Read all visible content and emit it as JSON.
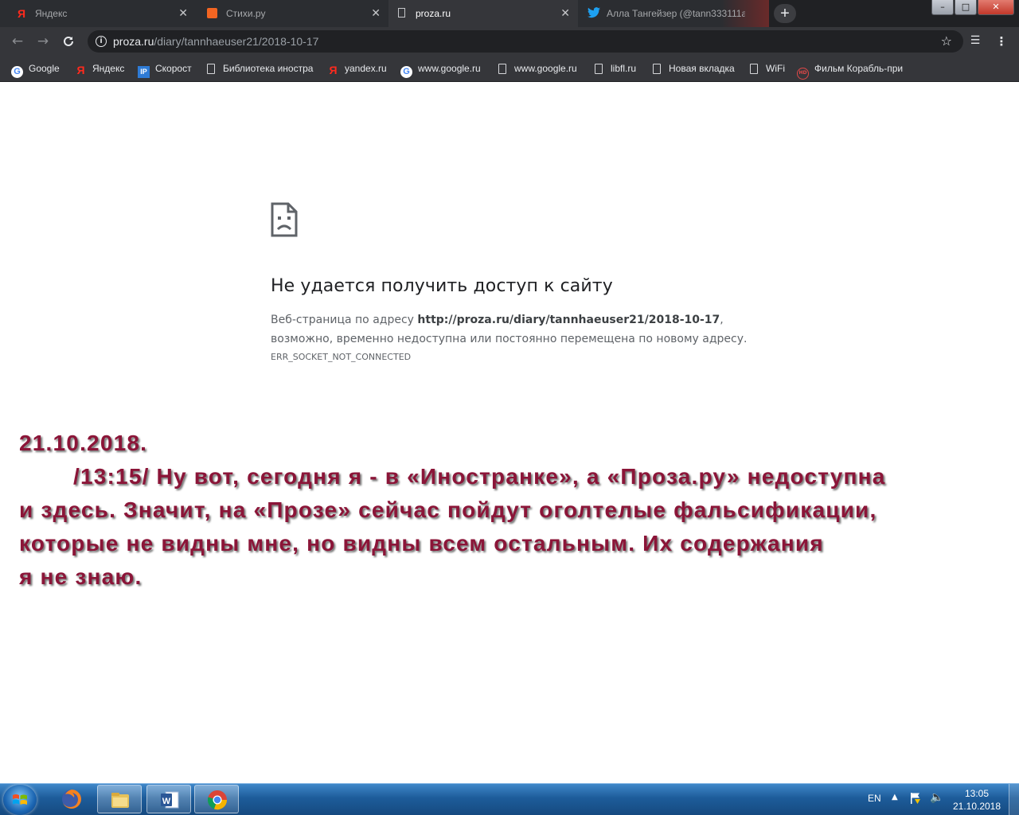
{
  "browser": {
    "tabs": [
      {
        "title": "Яндекс",
        "icon": "yandex-icon",
        "active": false
      },
      {
        "title": "Стихи.ру",
        "icon": "stihi-icon",
        "active": false
      },
      {
        "title": "proza.ru",
        "icon": "page-icon",
        "active": true
      },
      {
        "title": "Алла Тангейзер (@tann333111a",
        "icon": "twitter-icon",
        "active": false
      }
    ],
    "new_tab_symbol": "+",
    "window_controls": {
      "minimize": "–",
      "maximize": "□",
      "close": "✕"
    },
    "address": {
      "host": "proza.ru",
      "path": "/diary/tannhaeuser21/2018-10-17"
    },
    "bookmarks": [
      {
        "label": "Google",
        "icon": "google-icon"
      },
      {
        "label": "Яндекс",
        "icon": "yandex-icon"
      },
      {
        "label": "Скорост",
        "icon": "ip-icon"
      },
      {
        "label": "Библиотека иностра",
        "icon": "page-icon"
      },
      {
        "label": "yandex.ru",
        "icon": "yandex-icon"
      },
      {
        "label": "www.google.ru",
        "icon": "google-icon"
      },
      {
        "label": "www.google.ru",
        "icon": "page-icon"
      },
      {
        "label": "libfl.ru",
        "icon": "page-icon"
      },
      {
        "label": "Новая вкладка",
        "icon": "page-icon"
      },
      {
        "label": "WiFi",
        "icon": "page-icon"
      },
      {
        "label": "Фильм Корабль-при",
        "icon": "hd-icon"
      }
    ]
  },
  "error_page": {
    "title": "Не удается получить доступ к сайту",
    "message_prefix": "Веб-страница по адресу ",
    "url": "http://proza.ru/diary/tannhaeuser21/2018-10-17",
    "message_suffix": ",",
    "message_line2": "возможно, временно недоступна или постоянно перемещена по новому адресу.",
    "error_code": "ERR_SOCKET_NOT_CONNECTED"
  },
  "overlay_note": {
    "date": "21.10.2018.",
    "line1": "/13:15/ Ну вот, сегодня я - в «Иностранке», а «Проза.ру» недоступна",
    "line2": "и здесь. Значит, на «Прозе» сейчас пойдут оголтелые фальсификации,",
    "line3": "которые не видны мне, но видны всем остальным. Их содержания",
    "line4": "я не знаю.",
    "color": "#8b1538"
  },
  "taskbar": {
    "lang": "EN",
    "time": "13:05",
    "date": "21.10.2018",
    "apps": [
      "firefox-icon",
      "explorer-icon",
      "word-icon",
      "chrome-icon"
    ]
  }
}
